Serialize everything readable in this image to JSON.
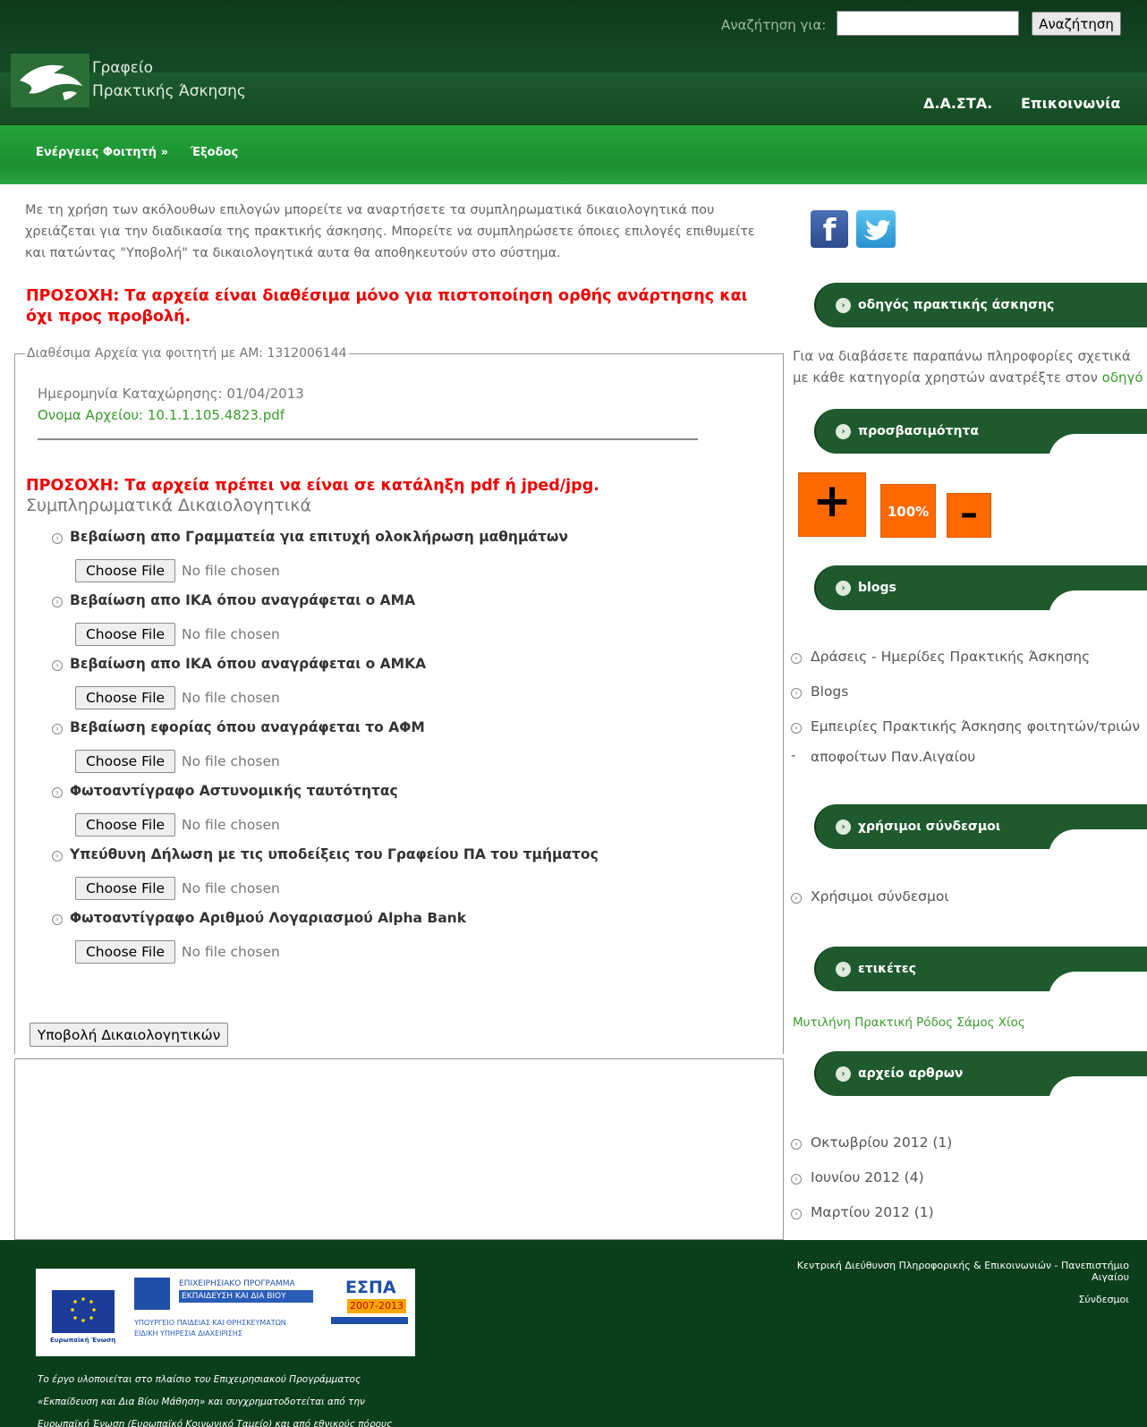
{
  "header": {
    "search_label": "Αναζήτηση για:",
    "search_value": "",
    "search_button": "Αναζήτηση",
    "logo_line1": "Γραφείο",
    "logo_line2": "Πρακτικής Άσκησης",
    "nav": [
      "Δ.Α.ΣΤΑ.",
      "Επικοινωνία"
    ]
  },
  "subnav": {
    "actions": "Ενέργειες Φοιτητή »",
    "exit": "Έξοδος"
  },
  "main": {
    "intro": "Με τη χρήση των ακόλουθων επιλογών μπορείτε να αναρτήσετε τα συμπληρωματικά δικαιολογητικά που χρειάζεται για την διαδικασία της πρακτικής άσκησης. Μπορείτε να συμπληρώσετε όποιες επιλογές επιθυμείτε και πατώντας \"Υποβολή\" τα δικαιολογητικά αυτα θα αποθηκευτούν στο σύστημα.",
    "warning1": "ΠΡΟΣΟΧΗ: Τα αρχεία είναι διαθέσιμα μόνο για πιστοποίηση ορθής ανάρτησης και όχι προς προβολή.",
    "files_legend": "Διαθέσιμα Αρχεία για φοιτητή με ΑΜ: 1312006144",
    "registration_date": "Ημερομηνία Καταχώρησης: 01/04/2013",
    "file_name": "Ονομα Αρχείου: 10.1.1.105.4823.pdf",
    "warning2": "ΠΡΟΣΟΧΗ: Τα αρχεία πρέπει να είναι σε κατάληξη pdf ή jped/jpg.",
    "docs_heading": "Συμπληρωματικά Δικαιολογητικά",
    "file_button": "Choose File",
    "file_status": "No file chosen",
    "documents": [
      "Βεβαίωση απο Γραμματεία για επιτυχή ολοκλήρωση μαθημάτων",
      "Βεβαίωση απο ΙΚΑ όπου αναγράφεται ο ΑΜΑ",
      "Βεβαίωση απο ΙΚΑ όπου αναγράφεται ο ΑΜΚΑ",
      "Βεβαίωση εφορίας όπου αναγράφεται το ΑΦΜ",
      "Φωτοαντίγραφο Αστυνομικής ταυτότητας",
      "Υπεύθυνη Δήλωση με τις υποδείξεις του Γραφείου ΠΑ του τμήματος",
      "Φωτοαντίγραφο Αριθμού Λογαριασμού Alpha Bank"
    ],
    "submit_button": "Υποβολή Δικαιολογητικών"
  },
  "sidebar": {
    "tabs": {
      "guide": "οδηγός πρακτικής άσκησης",
      "accessibility": "προσβασιμότητα",
      "blogs": "blogs",
      "links": "χρήσιμοι σύνδεσμοι",
      "tags": "ετικέτες",
      "archive": "αρχείο αρθρων"
    },
    "guide_text_line1": "Για να διαβάσετε παραπάνω πληροφορίες σχετικά",
    "guide_text_line2": "με κάθε κατηγορία χρηστών ανατρέξτε στον ",
    "guide_link": "οδηγό",
    "accessibility": {
      "plus": "+",
      "reset": "100%",
      "minus": "–"
    },
    "blog_items": [
      "Δράσεις - Ημερίδες Πρακτικής Άσκησης",
      "Blogs",
      "Εμπειρίες Πρακτικής Άσκησης φοιτητών/τριών -",
      "αποφοίτων Παν.Αιγαίου"
    ],
    "link_items": [
      "Χρήσιμοι σύνδεσμοι"
    ],
    "tags_text": "Μυτιλήνη Πρακτική Ρόδος Σάμος Χίος",
    "archive_items": [
      "Οκτωβρίου 2012 (1)",
      "Ιουνίου 2012 (4)",
      "Μαρτίου 2012 (1)"
    ]
  },
  "footer": {
    "eu_label": "Ευρωπαϊκή Ένωση",
    "op_title": "ΕΠΙΧΕΙΡΗΣΙΑΚΟ ΠΡΟΓΡΑΜΜΑ",
    "op_subtitle": "ΕΚΠΑΙΔΕΥΣΗ ΚΑΙ ΔΙΑ ΒΙΟΥ ΜΑΘΗΣΗ",
    "ministry": "ΥΠΟΥΡΓΕΙΟ ΠΑΙΔΕΙΑΣ ΚΑΙ ΘΡΗΣΚΕΥΜΑΤΩΝ",
    "service": "ΕΙΔΙΚΗ ΥΠΗΡΕΣΙΑ ΔΙΑΧΕΙΡΙΣΗΣ",
    "espa_title": "ΕΣΠΑ",
    "espa_years": "2007-2013",
    "description_line1": "Το έργο υλοποιείται στο πλαίσιο του Επιχειρησιακού Προγράμματος",
    "description_line2": "«Εκπαίδευση και Δια Βίου Μάθηση» και συγχρηματοδοτείται από την",
    "description_line3": "Ευρωπαϊκή Ένωση (Ευρωπαϊκό Κοινωνικό Ταμείο) και από εθνικούς πόρους",
    "credit": "Κεντρική Διεύθυνση Πληροφορικής & Επικοινωνιών - Πανεπιστήμιο Αιγαίου",
    "links": "Σύνδεσμοι"
  }
}
